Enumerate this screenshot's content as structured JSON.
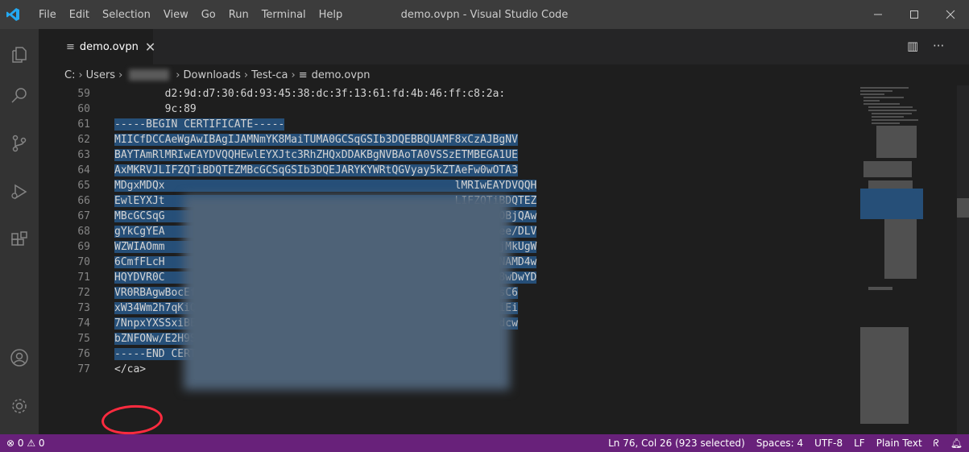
{
  "titlebar": {
    "menu": [
      "File",
      "Edit",
      "Selection",
      "View",
      "Go",
      "Run",
      "Terminal",
      "Help"
    ],
    "window_title": "demo.ovpn - Visual Studio Code"
  },
  "tab": {
    "label": "demo.ovpn",
    "close": "✕"
  },
  "breadcrumb": {
    "drive": "C:",
    "users": "Users",
    "downloads": "Downloads",
    "folder": "Test-ca",
    "file": "demo.ovpn"
  },
  "lines": [
    {
      "num": "59",
      "text": "        d2:9d:d7:30:6d:93:45:38:dc:3f:13:61:fd:4b:46:ff:c8:2a:"
    },
    {
      "num": "60",
      "text": "        9c:89"
    },
    {
      "num": "61",
      "text": "-----BEGIN CERTIFICATE-----"
    },
    {
      "num": "62",
      "text": "MIICfDCCAeWgAwIBAgIJAMNmYK8MaiTUMA0GCSqGSIb3DQEBBQUAMF8xCzAJBgNV"
    },
    {
      "num": "63",
      "text": "BAYTAmRlMRIwEAYDVQQHEwlEYXJtc3RhZHQxDDAKBgNVBAoTA0VSSzETMBEGA1UE"
    },
    {
      "num": "64",
      "text": "AxMKRVJLIFZQTiBDQTEZMBcGCSqGSIb3DQEJARYKYWRtQGVyay5kZTAeFw0wOTA3"
    },
    {
      "num": "65",
      "text": "MDgxMDQx                                              lMRIwEAYDVQQH"
    },
    {
      "num": "66",
      "text": "EwlEYXJt                                              LIFZQTiBDQTEZ"
    },
    {
      "num": "67",
      "text": "MBcGCSqG                                              BAQEFAAOBjQAw"
    },
    {
      "num": "68",
      "text": "gYkCgYEA                                              ZGAbQjpee/DLV"
    },
    {
      "num": "69",
      "text": "WZWIAOmm                                              DELyWOejMkUgW"
    },
    {
      "num": "70",
      "text": "6CmfFLcH                                              CAwEAAaNAMD4w"
    },
    {
      "num": "71",
      "text": "HQYDVR0C                                              FMAMBAf8wDwYD"
    },
    {
      "num": "72",
      "text": "VR0RBAgwBocEfwAAATANBgkqhkiG9w0BAQUFAAOBgQCDbByikbQ0+4mv+yGgWsC6"
    },
    {
      "num": "73",
      "text": "xW34Wm2h7qKiQcDhBZxw2d71GBNhnRhdPiWeO1aulcbWlRzEPni4xCsdBA5jOiEi"
    },
    {
      "num": "74",
      "text": "7NnpxYXSSxiBE+LGQls01SSEkO9UV+moxNxjJYgaoguY8neO4QXCBhQiqFnSndcw"
    },
    {
      "num": "75",
      "text": "bZNFONw/E2H9S0b/yCqciQ=="
    },
    {
      "num": "76",
      "text": "-----END CERTIFICATE-----"
    },
    {
      "num": "77",
      "text": "</ca>"
    }
  ],
  "status": {
    "problems": "⊗ 0 ⚠ 0",
    "position": "Ln 76, Col 26 (923 selected)",
    "spaces": "Spaces: 4",
    "encoding": "UTF-8",
    "eol": "LF",
    "language": "Plain Text"
  },
  "colors": {
    "statusbar": "#68217a",
    "selection": "#264f78",
    "annotation": "#ff2b3f"
  }
}
